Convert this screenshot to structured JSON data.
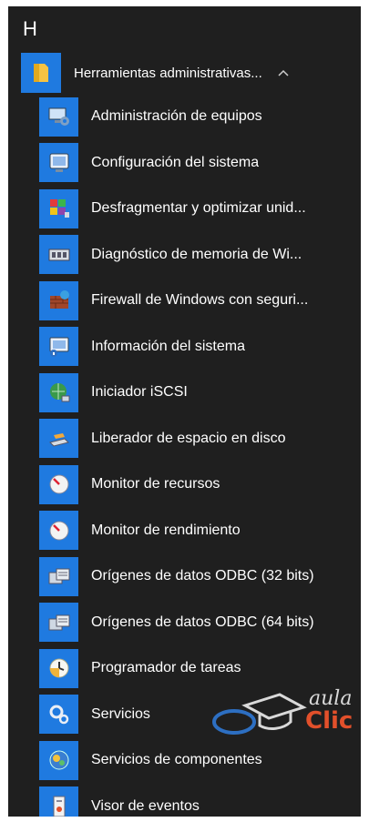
{
  "section_letter": "H",
  "folder": {
    "label": "Herramientas administrativas...",
    "chevron": "^",
    "icon": "folder-icon"
  },
  "items": [
    {
      "label": "Administración de equipos",
      "icon": "computer-management-icon"
    },
    {
      "label": "Configuración del sistema",
      "icon": "system-configuration-icon"
    },
    {
      "label": "Desfragmentar y optimizar unid...",
      "icon": "defragment-icon"
    },
    {
      "label": "Diagnóstico de memoria de Wi...",
      "icon": "memory-diagnostic-icon"
    },
    {
      "label": "Firewall de Windows con seguri...",
      "icon": "firewall-icon"
    },
    {
      "label": "Información del sistema",
      "icon": "system-information-icon"
    },
    {
      "label": "Iniciador iSCSI",
      "icon": "iscsi-initiator-icon"
    },
    {
      "label": "Liberador de espacio en disco",
      "icon": "disk-cleanup-icon"
    },
    {
      "label": "Monitor de recursos",
      "icon": "resource-monitor-icon"
    },
    {
      "label": "Monitor de rendimiento",
      "icon": "performance-monitor-icon"
    },
    {
      "label": "Orígenes de datos ODBC (32 bits)",
      "icon": "odbc-32-icon"
    },
    {
      "label": "Orígenes de datos ODBC (64 bits)",
      "icon": "odbc-64-icon"
    },
    {
      "label": "Programador de tareas",
      "icon": "task-scheduler-icon"
    },
    {
      "label": "Servicios",
      "icon": "services-icon"
    },
    {
      "label": "Servicios de componentes",
      "icon": "component-services-icon"
    },
    {
      "label": "Visor de eventos",
      "icon": "event-viewer-icon"
    }
  ],
  "watermark": {
    "line1": "aula",
    "line2": "Clic"
  },
  "colors": {
    "background": "#1f1f1f",
    "tile": "#1f7ae0",
    "text": "#ffffff",
    "watermark_accent": "#e2502b"
  }
}
